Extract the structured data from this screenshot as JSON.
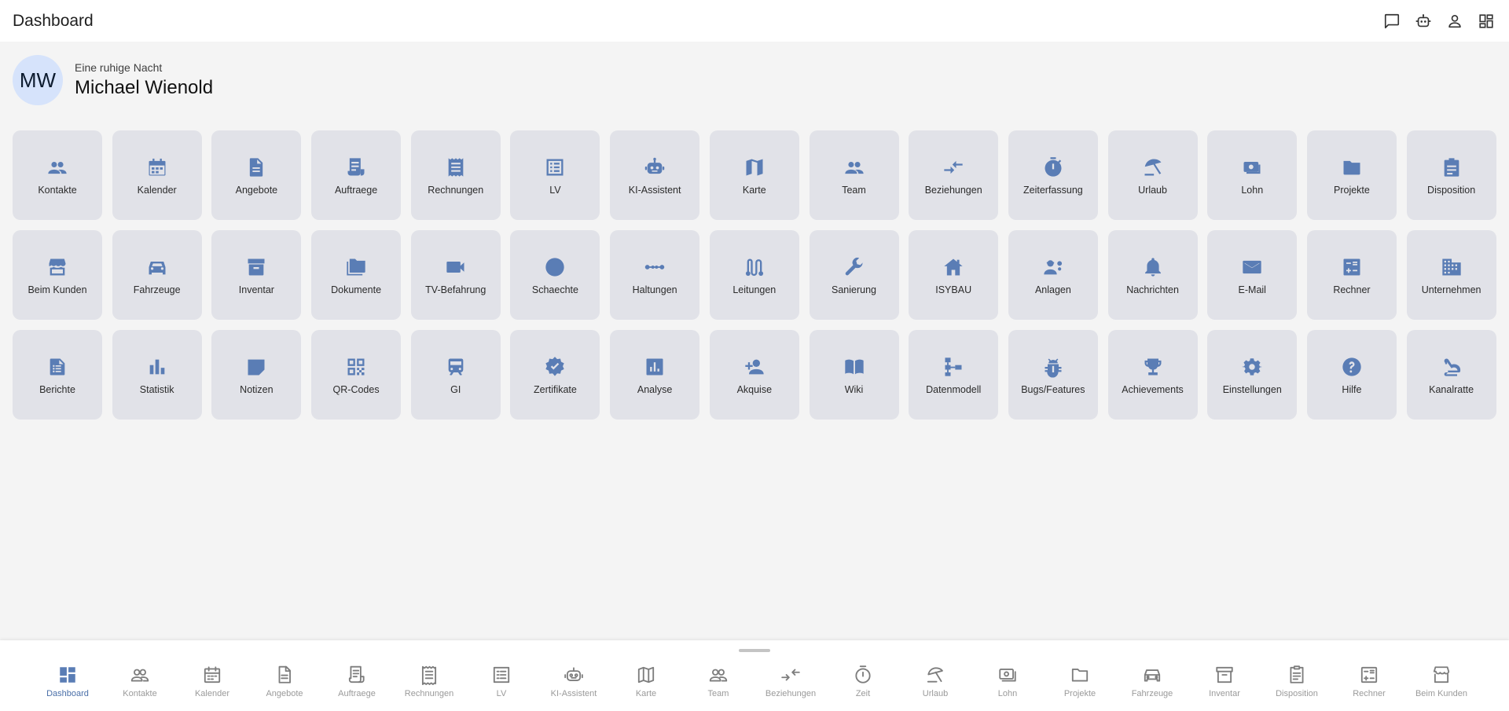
{
  "topbar": {
    "title": "Dashboard",
    "actions": [
      "chat-icon",
      "robot-icon",
      "person-icon",
      "dashboard-icon"
    ]
  },
  "profile": {
    "initials": "MW",
    "greeting": "Eine ruhige Nacht",
    "name": "Michael Wienold"
  },
  "colors": {
    "accent": "#5a7db5",
    "tile_bg": "#e1e2e8",
    "avatar_bg": "#d6e3fb",
    "page_bg": "#f4f4f4"
  },
  "tiles": [
    {
      "label": "Kontakte",
      "icon": "group-icon"
    },
    {
      "label": "Kalender",
      "icon": "calendar-icon"
    },
    {
      "label": "Angebote",
      "icon": "document-icon"
    },
    {
      "label": "Auftraege",
      "icon": "receipt-long-icon"
    },
    {
      "label": "Rechnungen",
      "icon": "receipt-icon"
    },
    {
      "label": "LV",
      "icon": "list-alt-icon"
    },
    {
      "label": "KI-Assistent",
      "icon": "robot-icon"
    },
    {
      "label": "Karte",
      "icon": "map-icon"
    },
    {
      "label": "Team",
      "icon": "group-icon"
    },
    {
      "label": "Beziehungen",
      "icon": "compare-arrows-icon"
    },
    {
      "label": "Zeiterfassung",
      "icon": "timer-icon"
    },
    {
      "label": "Urlaub",
      "icon": "beach-umbrella-icon"
    },
    {
      "label": "Lohn",
      "icon": "payments-icon"
    },
    {
      "label": "Projekte",
      "icon": "folder-icon"
    },
    {
      "label": "Disposition",
      "icon": "clipboard-icon"
    },
    {
      "label": "Beim Kunden",
      "icon": "storefront-icon"
    },
    {
      "label": "Fahrzeuge",
      "icon": "car-icon"
    },
    {
      "label": "Inventar",
      "icon": "archive-icon"
    },
    {
      "label": "Dokumente",
      "icon": "folder-copy-icon"
    },
    {
      "label": "TV-Befahrung",
      "icon": "videocam-icon"
    },
    {
      "label": "Schaechte",
      "icon": "circle-icon"
    },
    {
      "label": "Haltungen",
      "icon": "line-nodes-icon"
    },
    {
      "label": "Leitungen",
      "icon": "route-icon"
    },
    {
      "label": "Sanierung",
      "icon": "wrench-icon"
    },
    {
      "label": "ISYBAU",
      "icon": "house-icon"
    },
    {
      "label": "Anlagen",
      "icon": "engineering-icon"
    },
    {
      "label": "Nachrichten",
      "icon": "bell-icon"
    },
    {
      "label": "E-Mail",
      "icon": "mail-icon"
    },
    {
      "label": "Rechner",
      "icon": "calculate-icon"
    },
    {
      "label": "Unternehmen",
      "icon": "domain-icon"
    },
    {
      "label": "Berichte",
      "icon": "summarize-icon"
    },
    {
      "label": "Statistik",
      "icon": "bar-chart-icon"
    },
    {
      "label": "Notizen",
      "icon": "sticky-note-icon"
    },
    {
      "label": "QR-Codes",
      "icon": "qr-code-icon"
    },
    {
      "label": "GI",
      "icon": "train-icon"
    },
    {
      "label": "Zertifikate",
      "icon": "verified-icon"
    },
    {
      "label": "Analyse",
      "icon": "analytics-icon"
    },
    {
      "label": "Akquise",
      "icon": "person-add-icon"
    },
    {
      "label": "Wiki",
      "icon": "book-icon"
    },
    {
      "label": "Datenmodell",
      "icon": "schema-icon"
    },
    {
      "label": "Bugs/Features",
      "icon": "bug-icon"
    },
    {
      "label": "Achievements",
      "icon": "trophy-icon"
    },
    {
      "label": "Einstellungen",
      "icon": "gear-icon"
    },
    {
      "label": "Hilfe",
      "icon": "help-icon"
    },
    {
      "label": "Kanalratte",
      "icon": "rat-icon"
    }
  ],
  "bottom_nav": [
    {
      "label": "Dashboard",
      "icon": "dashboard-icon",
      "active": true
    },
    {
      "label": "Kontakte",
      "icon": "group-icon"
    },
    {
      "label": "Kalender",
      "icon": "calendar-icon"
    },
    {
      "label": "Angebote",
      "icon": "document-icon"
    },
    {
      "label": "Auftraege",
      "icon": "receipt-long-icon"
    },
    {
      "label": "Rechnungen",
      "icon": "receipt-icon"
    },
    {
      "label": "LV",
      "icon": "list-alt-icon"
    },
    {
      "label": "KI-Assistent",
      "icon": "robot-icon"
    },
    {
      "label": "Karte",
      "icon": "map-icon"
    },
    {
      "label": "Team",
      "icon": "group-icon"
    },
    {
      "label": "Beziehungen",
      "icon": "compare-arrows-icon"
    },
    {
      "label": "Zeit",
      "icon": "timer-icon"
    },
    {
      "label": "Urlaub",
      "icon": "beach-umbrella-icon"
    },
    {
      "label": "Lohn",
      "icon": "payments-icon"
    },
    {
      "label": "Projekte",
      "icon": "folder-icon"
    },
    {
      "label": "Fahrzeuge",
      "icon": "car-icon"
    },
    {
      "label": "Inventar",
      "icon": "archive-icon"
    },
    {
      "label": "Disposition",
      "icon": "clipboard-icon"
    },
    {
      "label": "Rechner",
      "icon": "calculate-icon"
    },
    {
      "label": "Beim Kunden",
      "icon": "storefront-icon"
    }
  ]
}
